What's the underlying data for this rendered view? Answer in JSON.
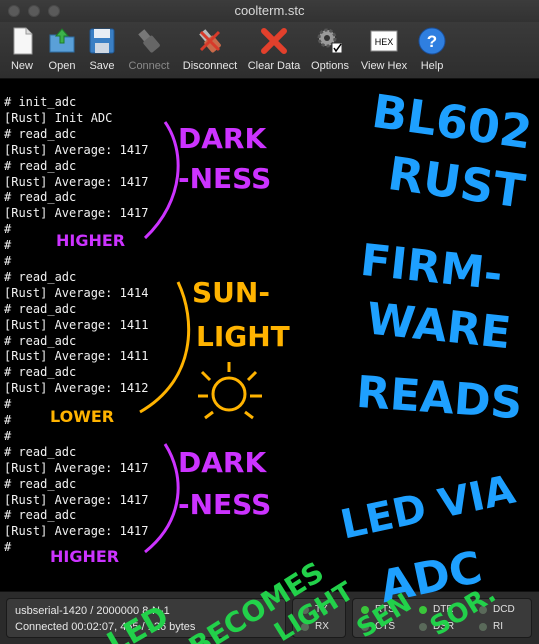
{
  "window": {
    "title": "coolterm.stc"
  },
  "toolbar": {
    "new": "New",
    "open": "Open",
    "save": "Save",
    "connect": "Connect",
    "disconnect": "Disconnect",
    "clear": "Clear Data",
    "options": "Options",
    "viewhex": "View Hex",
    "hex_icon_text": "HEX",
    "help": "Help"
  },
  "terminal": {
    "lines": [
      "# init_adc",
      "[Rust] Init ADC",
      "# read_adc",
      "[Rust] Average: 1417",
      "# read_adc",
      "[Rust] Average: 1417",
      "# read_adc",
      "[Rust] Average: 1417",
      "#",
      "#",
      "#",
      "# read_adc",
      "[Rust] Average: 1414",
      "# read_adc",
      "[Rust] Average: 1411",
      "# read_adc",
      "[Rust] Average: 1411",
      "# read_adc",
      "[Rust] Average: 1412",
      "#",
      "#",
      "#",
      "# read_adc",
      "[Rust] Average: 1417",
      "# read_adc",
      "[Rust] Average: 1417",
      "# read_adc",
      "[Rust] Average: 1417",
      "#"
    ]
  },
  "status": {
    "port": "usbserial-1420 / 2000000 8-N-1",
    "connection": "Connected 00:02:07, 465 / 126 bytes",
    "tx": "TX",
    "rx": "RX",
    "rts": "RTS",
    "cts": "CTS",
    "dtr": "DTR",
    "dsr": "DSR",
    "dcd": "DCD",
    "ri": "RI"
  },
  "annotations": {
    "dark1_a": "DARK",
    "dark1_b": "-NESS",
    "higher1": "HIGHER",
    "sun_a": "SUN-",
    "sun_b": "LIGHT",
    "lower": "LOWER",
    "dark2_a": "DARK",
    "dark2_b": "-NESS",
    "higher2": "HIGHER",
    "blue_1": "BL602",
    "blue_2": "RUST",
    "blue_3": "FIRM-",
    "blue_4": "WARE",
    "blue_5": "READS",
    "blue_6": "LED VIA",
    "blue_7": "ADC",
    "green_1": "LED",
    "green_2": "BECOMES",
    "green_3": "LIGHT",
    "green_4": "SEN",
    "green_5": "SOR."
  },
  "colors": {
    "magenta": "#cc33ff",
    "orange": "#ffb300",
    "blue": "#1ea0ff",
    "green": "#22d14a",
    "led_green": "#3ac63a",
    "led_off": "#5a6a5a"
  },
  "icons": [
    "new-document-icon",
    "open-folder-icon",
    "save-disk-icon",
    "usb-plug-icon",
    "disconnect-icon",
    "clear-x-icon",
    "options-gear-icon",
    "hex-icon",
    "help-icon"
  ]
}
